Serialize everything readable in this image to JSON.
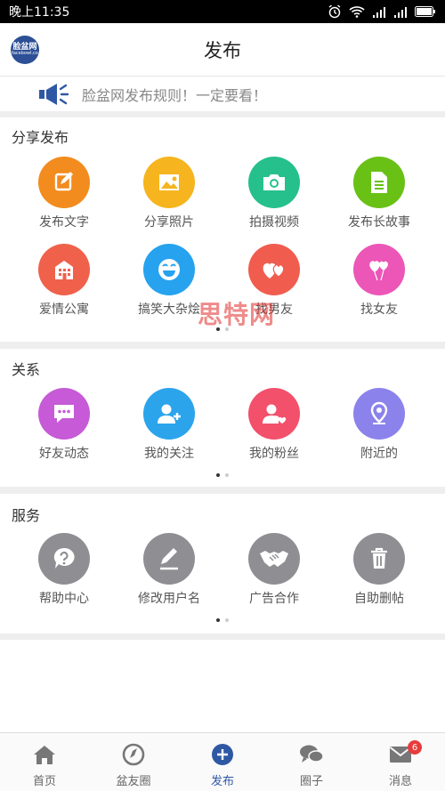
{
  "status_bar": {
    "time": "晚上11:35"
  },
  "header": {
    "title": "发布",
    "logo_text": "脸盆网",
    "logo_sub": "facebowl.co"
  },
  "notice": {
    "text": "脸盆网发布规则！一定要看！"
  },
  "sections": [
    {
      "title": "分享发布",
      "items": [
        {
          "label": "发布文字",
          "icon": "edit-icon",
          "color": "#f28c1f"
        },
        {
          "label": "分享照片",
          "icon": "photo-icon",
          "color": "#f6b51e"
        },
        {
          "label": "拍摄视频",
          "icon": "camera-icon",
          "color": "#26c08c"
        },
        {
          "label": "发布长故事",
          "icon": "document-icon",
          "color": "#69c116"
        },
        {
          "label": "爱情公寓",
          "icon": "building-icon",
          "color": "#f0614b"
        },
        {
          "label": "搞笑大杂烩",
          "icon": "laugh-face-icon",
          "color": "#26a2ef"
        },
        {
          "label": "找男友",
          "icon": "hearts-icon",
          "color": "#f05d4f"
        },
        {
          "label": "找女友",
          "icon": "hearts-balloon-icon",
          "color": "#eb56b7"
        }
      ]
    },
    {
      "title": "关系",
      "items": [
        {
          "label": "好友动态",
          "icon": "chat-bubble-icon",
          "color": "#c65ad7"
        },
        {
          "label": "我的关注",
          "icon": "add-user-icon",
          "color": "#2ba4ec"
        },
        {
          "label": "我的粉丝",
          "icon": "user-heart-icon",
          "color": "#f2506b"
        },
        {
          "label": "附近的",
          "icon": "location-pin-icon",
          "color": "#8c82ec"
        }
      ]
    },
    {
      "title": "服务",
      "items": [
        {
          "label": "帮助中心",
          "icon": "help-icon",
          "color": "#8e8e93"
        },
        {
          "label": "修改用户名",
          "icon": "pen-icon",
          "color": "#8e8e93"
        },
        {
          "label": "广告合作",
          "icon": "handshake-icon",
          "color": "#8e8e93"
        },
        {
          "label": "自助删帖",
          "icon": "trash-icon",
          "color": "#8e8e93"
        }
      ]
    }
  ],
  "watermark": "思特网",
  "tabbar": [
    {
      "label": "首页",
      "icon": "home-icon"
    },
    {
      "label": "盆友圈",
      "icon": "compass-icon"
    },
    {
      "label": "发布",
      "icon": "plus-circle-icon",
      "active": true
    },
    {
      "label": "圈子",
      "icon": "chat-icon"
    },
    {
      "label": "消息",
      "icon": "mail-icon",
      "badge": "6"
    }
  ],
  "colors": {
    "accent": "#2f58a4",
    "section_gap": "#eeeeee",
    "service_gray": "#8e8e93",
    "badge": "#e83b3b"
  }
}
